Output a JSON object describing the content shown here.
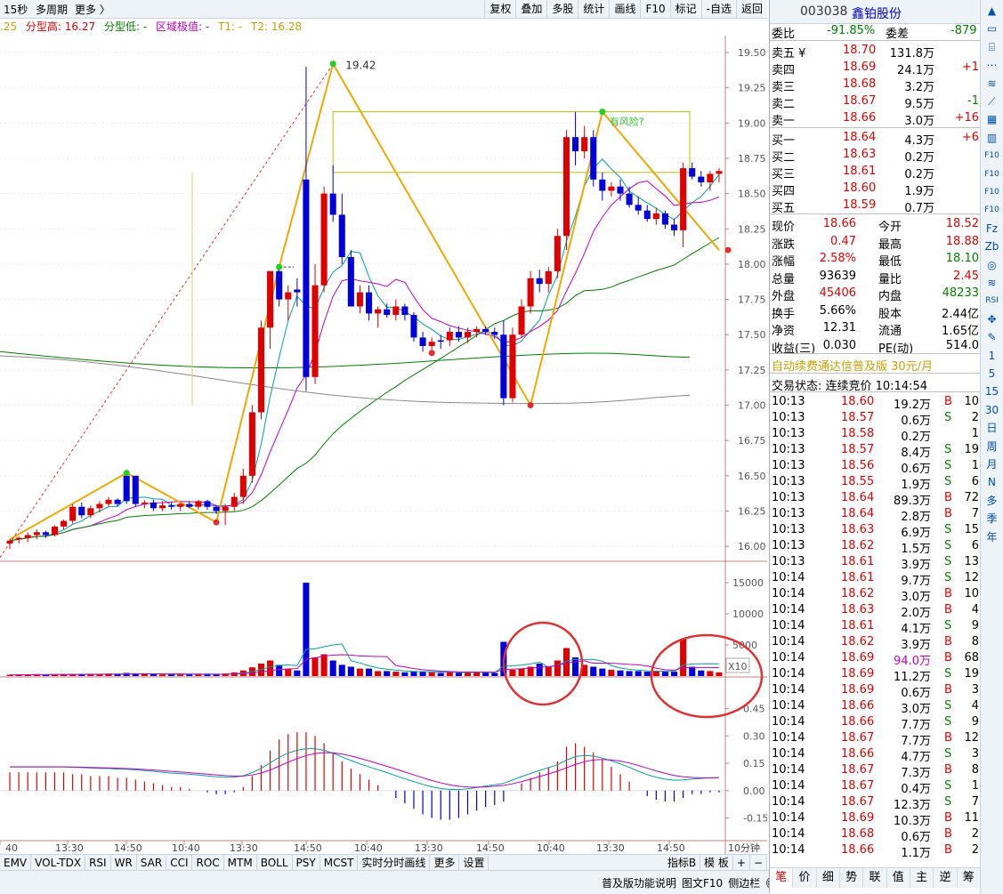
{
  "toolbar": {
    "period": "15秒",
    "multi_period": "多周期",
    "more": "更多 〉",
    "buttons": [
      "复权",
      "叠加",
      "多股",
      "统计",
      "画线",
      "F10",
      "标记",
      "-自选",
      "返回"
    ]
  },
  "infobar": {
    "prefix": ".25",
    "type_high": "分型高: 16.27",
    "type_low": "分型低: -",
    "region": "区域极值: -",
    "t1": "T1: -",
    "t2": "T2: 16.28"
  },
  "price_axis": [
    "19.50",
    "19.25",
    "19.00",
    "18.75",
    "18.50",
    "18.25",
    "18.00",
    "17.75",
    "17.50",
    "17.25",
    "17.00",
    "16.75",
    "16.50",
    "16.25",
    "16.00"
  ],
  "volume_axis": [
    "15000",
    "10000",
    "5000"
  ],
  "volume_tag": "X10",
  "macd_axis": [
    "0.45",
    "0.30",
    "0.15",
    "0.00",
    "-0.15"
  ],
  "time_axis": [
    "40",
    "13:30",
    "14:50",
    "10:40",
    "13:30",
    "14:50",
    "10:40",
    "13:30",
    "14:50",
    "10:40",
    "13:30",
    "14:50"
  ],
  "time_unit": "10分钟",
  "chart_labels": {
    "peak": "19.42",
    "risk": "有风险?"
  },
  "chart_data": {
    "type": "candlestick",
    "price_ylim": [
      15.9,
      19.62
    ],
    "candles": [
      [
        16.02,
        16.05,
        15.98,
        16.04,
        1
      ],
      [
        16.05,
        16.07,
        16.02,
        16.06,
        1
      ],
      [
        16.06,
        16.1,
        16.03,
        16.08,
        1
      ],
      [
        16.08,
        16.12,
        16.05,
        16.1,
        1
      ],
      [
        16.1,
        16.11,
        16.06,
        16.08,
        0
      ],
      [
        16.08,
        16.15,
        16.07,
        16.14,
        1
      ],
      [
        16.14,
        16.19,
        16.12,
        16.18,
        1
      ],
      [
        16.18,
        16.3,
        16.16,
        16.28,
        1
      ],
      [
        16.28,
        16.31,
        16.2,
        16.22,
        0
      ],
      [
        16.22,
        16.29,
        16.2,
        16.27,
        1
      ],
      [
        16.27,
        16.32,
        16.24,
        16.3,
        1
      ],
      [
        16.3,
        16.35,
        16.28,
        16.33,
        1
      ],
      [
        16.33,
        16.34,
        16.28,
        16.3,
        0
      ],
      [
        16.32,
        16.52,
        16.3,
        16.5,
        0
      ],
      [
        16.5,
        16.48,
        16.28,
        16.3,
        0
      ],
      [
        16.3,
        16.33,
        16.27,
        16.31,
        1
      ],
      [
        16.31,
        16.33,
        16.25,
        16.27,
        0
      ],
      [
        16.27,
        16.32,
        16.25,
        16.29,
        1
      ],
      [
        16.29,
        16.31,
        16.26,
        16.28,
        0
      ],
      [
        16.28,
        16.31,
        16.25,
        16.3,
        1
      ],
      [
        16.3,
        16.32,
        16.27,
        16.28,
        0
      ],
      [
        16.28,
        16.33,
        16.26,
        16.32,
        1
      ],
      [
        16.32,
        16.33,
        16.26,
        16.28,
        0
      ],
      [
        16.28,
        16.29,
        16.23,
        16.25,
        0
      ],
      [
        16.25,
        16.3,
        16.15,
        16.28,
        1
      ],
      [
        16.28,
        16.38,
        16.25,
        16.35,
        1
      ],
      [
        16.35,
        16.55,
        16.3,
        16.5,
        1
      ],
      [
        16.5,
        17.0,
        16.45,
        16.95,
        1
      ],
      [
        16.95,
        17.6,
        16.9,
        17.55,
        1
      ],
      [
        17.55,
        17.95,
        17.4,
        17.95,
        1
      ],
      [
        17.95,
        17.98,
        17.7,
        17.75,
        0
      ],
      [
        17.75,
        17.85,
        17.6,
        17.8,
        1
      ],
      [
        17.8,
        17.9,
        17.7,
        17.82,
        0
      ],
      [
        18.6,
        19.4,
        17.1,
        17.2,
        0
      ],
      [
        17.2,
        18.0,
        17.15,
        17.85,
        1
      ],
      [
        17.85,
        18.55,
        17.8,
        18.5,
        1
      ],
      [
        18.5,
        18.7,
        18.3,
        18.35,
        0
      ],
      [
        18.35,
        18.5,
        18.0,
        18.05,
        0
      ],
      [
        18.05,
        18.1,
        17.7,
        17.7,
        0
      ],
      [
        17.7,
        17.85,
        17.65,
        17.8,
        1
      ],
      [
        17.8,
        17.85,
        17.6,
        17.65,
        0
      ],
      [
        17.65,
        17.7,
        17.55,
        17.68,
        1
      ],
      [
        17.68,
        17.72,
        17.62,
        17.64,
        0
      ],
      [
        17.64,
        17.75,
        17.6,
        17.7,
        1
      ],
      [
        17.7,
        17.72,
        17.6,
        17.64,
        0
      ],
      [
        17.64,
        17.66,
        17.45,
        17.48,
        0
      ],
      [
        17.48,
        17.52,
        17.38,
        17.42,
        0
      ],
      [
        17.42,
        17.48,
        17.36,
        17.45,
        1
      ],
      [
        17.45,
        17.5,
        17.4,
        17.46,
        0
      ],
      [
        17.46,
        17.55,
        17.42,
        17.52,
        1
      ],
      [
        17.52,
        17.56,
        17.45,
        17.48,
        0
      ],
      [
        17.48,
        17.55,
        17.44,
        17.52,
        1
      ],
      [
        17.52,
        17.56,
        17.48,
        17.54,
        1
      ],
      [
        17.54,
        17.56,
        17.5,
        17.52,
        0
      ],
      [
        17.52,
        17.55,
        17.47,
        17.5,
        0
      ],
      [
        17.5,
        17.6,
        17.0,
        17.05,
        0
      ],
      [
        17.05,
        17.55,
        17.02,
        17.5,
        1
      ],
      [
        17.5,
        17.75,
        17.48,
        17.7,
        1
      ],
      [
        17.7,
        17.95,
        17.65,
        17.9,
        1
      ],
      [
        17.9,
        17.96,
        17.8,
        17.86,
        0
      ],
      [
        17.86,
        17.98,
        17.8,
        17.95,
        1
      ],
      [
        17.95,
        18.25,
        17.9,
        18.2,
        1
      ],
      [
        18.2,
        18.95,
        18.1,
        18.9,
        1
      ],
      [
        18.9,
        19.08,
        18.7,
        18.8,
        0
      ],
      [
        18.8,
        18.98,
        18.75,
        18.9,
        1
      ],
      [
        18.9,
        18.95,
        18.55,
        18.6,
        0
      ],
      [
        18.6,
        18.65,
        18.45,
        18.52,
        0
      ],
      [
        18.52,
        18.58,
        18.48,
        18.55,
        1
      ],
      [
        18.55,
        18.6,
        18.45,
        18.5,
        0
      ],
      [
        18.5,
        18.55,
        18.4,
        18.42,
        0
      ],
      [
        18.42,
        18.48,
        18.35,
        18.38,
        0
      ],
      [
        18.38,
        18.42,
        18.3,
        18.32,
        0
      ],
      [
        18.32,
        18.4,
        18.28,
        18.36,
        1
      ],
      [
        18.36,
        18.38,
        18.25,
        18.28,
        0
      ],
      [
        18.28,
        18.32,
        18.2,
        18.24,
        0
      ],
      [
        18.24,
        18.72,
        18.12,
        18.68,
        1
      ],
      [
        18.68,
        18.72,
        18.6,
        18.62,
        0
      ],
      [
        18.62,
        18.66,
        18.55,
        18.58,
        0
      ],
      [
        18.58,
        18.66,
        18.52,
        18.64,
        1
      ],
      [
        18.64,
        18.68,
        18.58,
        18.66,
        1
      ]
    ],
    "volume_ylim": [
      0,
      16000
    ],
    "volumes": [
      200,
      200,
      250,
      300,
      200,
      300,
      250,
      350,
      300,
      300,
      300,
      400,
      300,
      500,
      400,
      300,
      300,
      250,
      300,
      300,
      250,
      300,
      300,
      250,
      400,
      600,
      900,
      1400,
      2000,
      2500,
      1800,
      1200,
      900,
      15000,
      3000,
      3500,
      2500,
      1800,
      1500,
      1200,
      1200,
      800,
      800,
      700,
      600,
      800,
      700,
      600,
      500,
      600,
      500,
      600,
      700,
      600,
      500,
      5500,
      1000,
      1200,
      1500,
      2000,
      1500,
      2500,
      4500,
      3000,
      1800,
      1500,
      1200,
      1000,
      900,
      800,
      800,
      700,
      800,
      700,
      700,
      6000,
      1500,
      900,
      800,
      600
    ],
    "macd_ylim": [
      -0.25,
      0.55
    ],
    "macd": [
      0.1,
      0.1,
      0.1,
      0.1,
      0.1,
      0.1,
      0.1,
      0.09,
      0.09,
      0.08,
      0.08,
      0.08,
      0.07,
      0.07,
      0.06,
      0.05,
      0.04,
      0.03,
      0.02,
      0.02,
      0.01,
      0.0,
      -0.01,
      -0.02,
      -0.02,
      -0.01,
      0.02,
      0.08,
      0.14,
      0.22,
      0.28,
      0.31,
      0.32,
      0.32,
      0.3,
      0.26,
      0.21,
      0.16,
      0.12,
      0.09,
      0.06,
      0.03,
      0.0,
      -0.04,
      -0.07,
      -0.1,
      -0.13,
      -0.15,
      -0.16,
      -0.16,
      -0.15,
      -0.13,
      -0.11,
      -0.09,
      -0.08,
      -0.06,
      0.0,
      0.04,
      0.07,
      0.1,
      0.13,
      0.16,
      0.24,
      0.26,
      0.24,
      0.21,
      0.17,
      0.13,
      0.09,
      0.05,
      0.0,
      -0.03,
      -0.05,
      -0.06,
      -0.06,
      -0.04,
      -0.02,
      -0.02,
      -0.01,
      -0.01
    ]
  },
  "stock": {
    "code": "003038",
    "name": "鑫铂股份"
  },
  "orderbook": {
    "weibi_label": "委比",
    "weibi": "-91.85%",
    "weicha_label": "委差",
    "weicha": "-879",
    "asks": [
      {
        "label": "卖五 ¥",
        "price": "18.70",
        "vol": "131.8万",
        "chg": ""
      },
      {
        "label": "卖四",
        "price": "18.69",
        "vol": "24.1万",
        "chg": "+1"
      },
      {
        "label": "卖三",
        "price": "18.68",
        "vol": "3.2万",
        "chg": ""
      },
      {
        "label": "卖二",
        "price": "18.67",
        "vol": "9.5万",
        "chg": "-1"
      },
      {
        "label": "卖一",
        "price": "18.66",
        "vol": "3.0万",
        "chg": "+16"
      }
    ],
    "bids": [
      {
        "label": "买一",
        "price": "18.64",
        "vol": "4.3万",
        "chg": "+6"
      },
      {
        "label": "买二",
        "price": "18.63",
        "vol": "0.2万",
        "chg": ""
      },
      {
        "label": "买三",
        "price": "18.61",
        "vol": "0.2万",
        "chg": ""
      },
      {
        "label": "买四",
        "price": "18.60",
        "vol": "1.9万",
        "chg": ""
      },
      {
        "label": "买五",
        "price": "18.59",
        "vol": "0.7万",
        "chg": ""
      }
    ]
  },
  "quote": [
    {
      "l1": "现价",
      "v1": "18.66",
      "c1": "red",
      "l2": "今开",
      "v2": "18.52",
      "c2": "red"
    },
    {
      "l1": "涨跌",
      "v1": "0.47",
      "c1": "red",
      "l2": "最高",
      "v2": "18.88",
      "c2": "red"
    },
    {
      "l1": "涨幅",
      "v1": "2.58%",
      "c1": "red",
      "l2": "最低",
      "v2": "18.10",
      "c2": "green"
    },
    {
      "l1": "总量",
      "v1": "93639",
      "c1": "black",
      "l2": "量比",
      "v2": "2.45",
      "c2": "red"
    },
    {
      "l1": "外盘",
      "v1": "45406",
      "c1": "red",
      "l2": "内盘",
      "v2": "48233",
      "c2": "green"
    },
    {
      "l1": "换手",
      "v1": "5.66%",
      "c1": "black",
      "l2": "股本",
      "v2": "2.44亿",
      "c2": "black"
    },
    {
      "l1": "净资",
      "v1": "12.31",
      "c1": "black",
      "l2": "流通",
      "v2": "1.65亿",
      "c2": "black"
    },
    {
      "l1": "收益(三)",
      "v1": "0.030",
      "c1": "black",
      "l2": "PE(动)",
      "v2": "514.0",
      "c2": "black"
    }
  ],
  "ad_text": "自动续费通达信普及版  30元/月",
  "trade_status": "交易状态: 连续竞价 10:14:54",
  "ticks": [
    [
      "10:13",
      "18.60",
      "19.2万",
      "B",
      "10"
    ],
    [
      "10:13",
      "18.57",
      "0.6万",
      "S",
      "2"
    ],
    [
      "10:13",
      "18.58",
      "0.2万",
      "",
      "1"
    ],
    [
      "10:13",
      "18.57",
      "8.4万",
      "S",
      "19"
    ],
    [
      "10:13",
      "18.56",
      "0.6万",
      "S",
      "1"
    ],
    [
      "10:13",
      "18.55",
      "1.9万",
      "S",
      "6"
    ],
    [
      "10:13",
      "18.64",
      "89.3万",
      "B",
      "72"
    ],
    [
      "10:13",
      "18.64",
      "2.8万",
      "B",
      "7"
    ],
    [
      "10:13",
      "18.63",
      "6.9万",
      "S",
      "15"
    ],
    [
      "10:13",
      "18.62",
      "1.5万",
      "S",
      "6"
    ],
    [
      "10:13",
      "18.61",
      "3.9万",
      "S",
      "13"
    ],
    [
      "10:14",
      "18.61",
      "9.7万",
      "S",
      "12"
    ],
    [
      "10:14",
      "18.62",
      "3.0万",
      "B",
      "10"
    ],
    [
      "10:14",
      "18.63",
      "2.0万",
      "B",
      "4"
    ],
    [
      "10:14",
      "18.61",
      "4.1万",
      "S",
      "9"
    ],
    [
      "10:14",
      "18.62",
      "3.9万",
      "B",
      "8"
    ],
    [
      "10:14",
      "18.69",
      "94.0万",
      "B",
      "68"
    ],
    [
      "10:14",
      "18.69",
      "11.2万",
      "S",
      "19"
    ],
    [
      "10:14",
      "18.69",
      "0.6万",
      "B",
      "3"
    ],
    [
      "10:14",
      "18.66",
      "3.0万",
      "S",
      "4"
    ],
    [
      "10:14",
      "18.66",
      "7.7万",
      "S",
      "9"
    ],
    [
      "10:14",
      "18.67",
      "7.7万",
      "B",
      "12"
    ],
    [
      "10:14",
      "18.66",
      "4.7万",
      "S",
      "3"
    ],
    [
      "10:14",
      "18.67",
      "7.3万",
      "B",
      "8"
    ],
    [
      "10:14",
      "18.67",
      "0.4万",
      "S",
      "1"
    ],
    [
      "10:14",
      "18.67",
      "12.3万",
      "S",
      "7"
    ],
    [
      "10:14",
      "18.69",
      "10.3万",
      "B",
      "11"
    ],
    [
      "10:14",
      "18.68",
      "0.6万",
      "B",
      "2"
    ],
    [
      "10:14",
      "18.66",
      "1.1万",
      "B",
      "2"
    ]
  ],
  "bottom_tabs": [
    "EMV",
    "VOL-TDX",
    "RSI",
    "WR",
    "SAR",
    "CCI",
    "ROC",
    "MTM",
    "BOLL",
    "PSY",
    "MCST",
    "实时分时画线",
    "更多",
    "设置"
  ],
  "bottom_right": [
    "指标B",
    "模 板",
    "+",
    "−"
  ],
  "right_tabs": [
    "笔",
    "价",
    "细",
    "势",
    "联",
    "值",
    "主",
    "逆",
    "筹"
  ],
  "status_links": [
    "普及版功能说明",
    "图文F10",
    "侧边栏《"
  ],
  "side_icons": [
    "▲",
    "▭",
    "⌸",
    "⋯",
    "≋",
    "⟋",
    "▦",
    "▥",
    "F10",
    "F10",
    "F10",
    "F10",
    "Fz",
    "Zb",
    "◎",
    "≋",
    "RSI",
    "✥",
    "✎",
    "1",
    "5",
    "15",
    "30",
    "日",
    "周",
    "月",
    "N",
    "多",
    "季",
    "年"
  ],
  "colors": {
    "up": "#e00000",
    "down": "#0000dd",
    "ma_green": "#008000",
    "zig": "#f0a800",
    "circle": "#e03030"
  }
}
